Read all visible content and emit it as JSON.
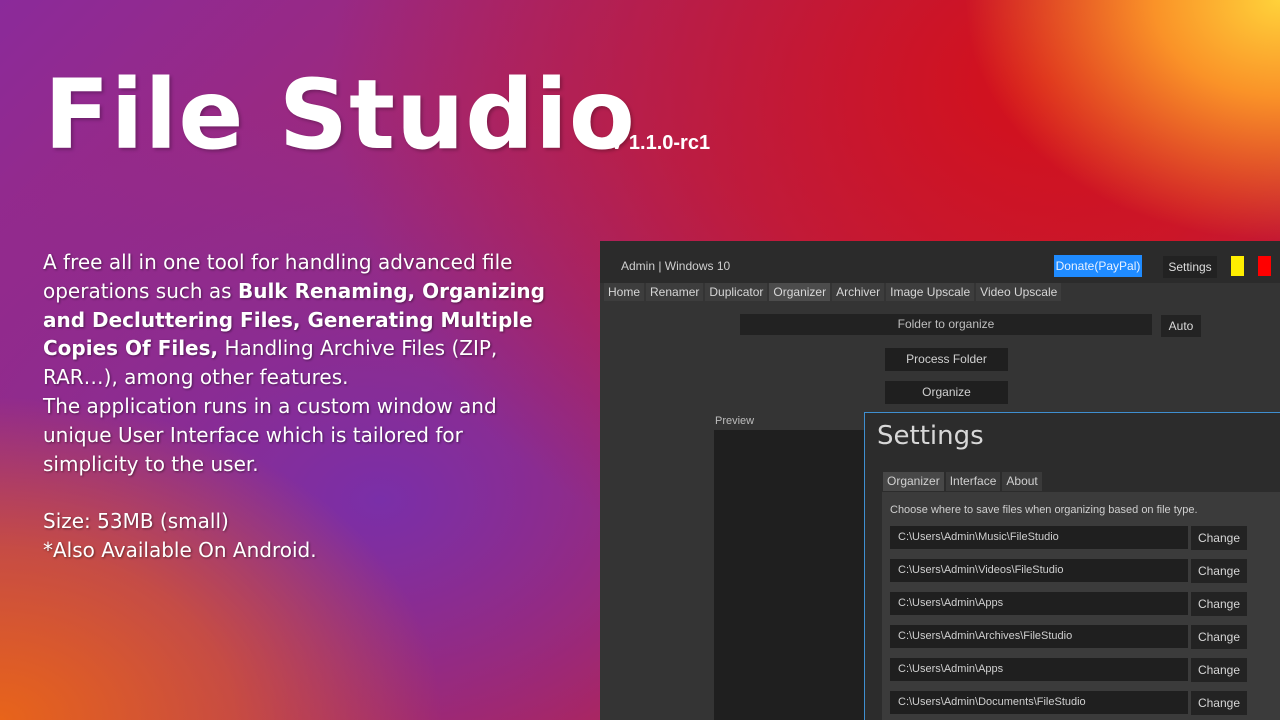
{
  "hero": {
    "title": "File Studio",
    "version": "V 1.1.0-rc1"
  },
  "description": {
    "p1_a": "A free all in one tool for handling advanced file operations such as ",
    "p1_bold1": "Bulk Renaming, Organizing and Decluttering Files, Generating Multiple Copies Of Files,",
    "p1_b": " Handling Archive Files (ZIP, RAR…), among other features.",
    "p2": "The application runs in a custom window and unique User Interface which is tailored for simplicity to the user.",
    "size": "Size: 53MB (small)",
    "android": "*Also Available On Android."
  },
  "app": {
    "window_title": "Admin | Windows 10",
    "donate_label": "Donate(PayPal)",
    "settings_label": "Settings",
    "tabs": [
      "Home",
      "Renamer",
      "Duplicator",
      "Organizer",
      "Archiver",
      "Image Upscale",
      "Video Upscale"
    ],
    "active_tab": "Organizer",
    "folder_placeholder": "Folder to organize",
    "auto_label": "Auto",
    "process_label": "Process Folder",
    "organize_label": "Organize",
    "preview_label": "Preview",
    "colors": {
      "accent": "#1f8bff",
      "yellow": "#ffee00",
      "red": "#ff0000"
    }
  },
  "settings": {
    "title": "Settings",
    "tabs": [
      "Organizer",
      "Interface",
      "About"
    ],
    "description": "Choose where to save files when organizing based on file type.",
    "change_label": "Change",
    "paths": [
      "C:\\Users\\Admin\\Music\\FileStudio",
      "C:\\Users\\Admin\\Videos\\FileStudio",
      "C:\\Users\\Admin\\Apps",
      "C:\\Users\\Admin\\Archives\\FileStudio",
      "C:\\Users\\Admin\\Apps",
      "C:\\Users\\Admin\\Documents\\FileStudio"
    ]
  }
}
